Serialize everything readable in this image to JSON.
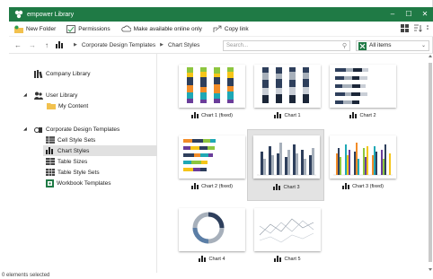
{
  "window": {
    "title": "empower Library",
    "minimize": "–",
    "maximize": "☐",
    "close": "✕"
  },
  "toolbar": {
    "new_folder": "New Folder",
    "permissions": "Permissions",
    "offline": "Make available online only",
    "copy_link": "Copy link"
  },
  "nav": {
    "breadcrumb": [
      "Corporate Design Templates",
      "Chart Styles"
    ],
    "search_placeholder": "Search...",
    "filter": "All items"
  },
  "sidebar": {
    "company_library": "Company Library",
    "user_library": "User Library",
    "my_content": "My Content",
    "corporate": "Corporate Design Templates",
    "cell_style_sets": "Cell Style Sets",
    "chart_styles": "Chart Styles",
    "table_sizes": "Table Sizes",
    "table_style_sets": "Table Style Sets",
    "workbook_templates": "Workbook Templates"
  },
  "tiles": [
    {
      "label": "Chart  1 (fixed)"
    },
    {
      "label": "Chart 1"
    },
    {
      "label": "Chart 2"
    },
    {
      "label": "Chart 2 (fixed)"
    },
    {
      "label": "Chart 3"
    },
    {
      "label": "Chart 3 (fixed)"
    },
    {
      "label": "Chart 4"
    },
    {
      "label": "Chart 5"
    }
  ],
  "status": "0 elements selected",
  "colors": {
    "accent": "#1f7a45",
    "navy": "#2e3f5c",
    "gray": "#a7b0bb",
    "orange": "#f28c28",
    "teal": "#1fa8b5",
    "green": "#8dc63f",
    "yellow": "#f5c518",
    "purple": "#6a3d9a"
  }
}
